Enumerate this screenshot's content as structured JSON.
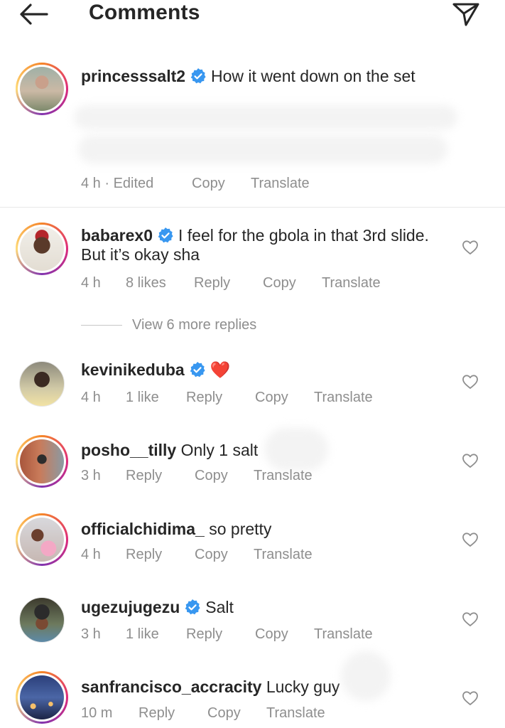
{
  "header": {
    "title": "Comments"
  },
  "comments": [
    {
      "username": "princesssalt2",
      "verified": true,
      "text": "How it went down on the set",
      "time": "4 h · Edited",
      "likes": "",
      "actions": {
        "copy": "Copy",
        "translate": "Translate"
      }
    },
    {
      "username": "babarex0",
      "verified": true,
      "text": "I feel for the gbola in that 3rd slide.  But it’s okay sha",
      "time": "4 h",
      "likes": "8 likes",
      "actions": {
        "reply": "Reply",
        "copy": "Copy",
        "translate": "Translate"
      }
    },
    {
      "username": "kevinikeduba",
      "verified": true,
      "text": "❤️",
      "time": "4 h",
      "likes": "1 like",
      "actions": {
        "reply": "Reply",
        "copy": "Copy",
        "translate": "Translate"
      }
    },
    {
      "username": "posho__tilly",
      "verified": false,
      "text": "Only 1 salt",
      "time": "3 h",
      "likes": "",
      "actions": {
        "reply": "Reply",
        "copy": "Copy",
        "translate": "Translate"
      }
    },
    {
      "username": "officialchidima_",
      "verified": false,
      "text": "so pretty",
      "time": "4 h",
      "likes": "",
      "actions": {
        "reply": "Reply",
        "copy": "Copy",
        "translate": "Translate"
      }
    },
    {
      "username": "ugezujugezu",
      "verified": true,
      "text": "Salt",
      "time": "3 h",
      "likes": "1 like",
      "actions": {
        "reply": "Reply",
        "copy": "Copy",
        "translate": "Translate"
      }
    },
    {
      "username": "sanfrancisco_accracity",
      "verified": false,
      "text": "Lucky guy",
      "time": "10 m",
      "likes": "",
      "actions": {
        "reply": "Reply",
        "copy": "Copy",
        "translate": "Translate"
      }
    }
  ],
  "view_replies": "View 6 more replies",
  "icons": {
    "back": "back-arrow-icon",
    "send": "send-icon",
    "verified": "verified-badge-icon",
    "like": "heart-outline-icon"
  },
  "colors": {
    "text": "#262626",
    "secondary": "#8e8e8e",
    "verified": "#3897f0",
    "emoji_heart": "#e0245e"
  }
}
